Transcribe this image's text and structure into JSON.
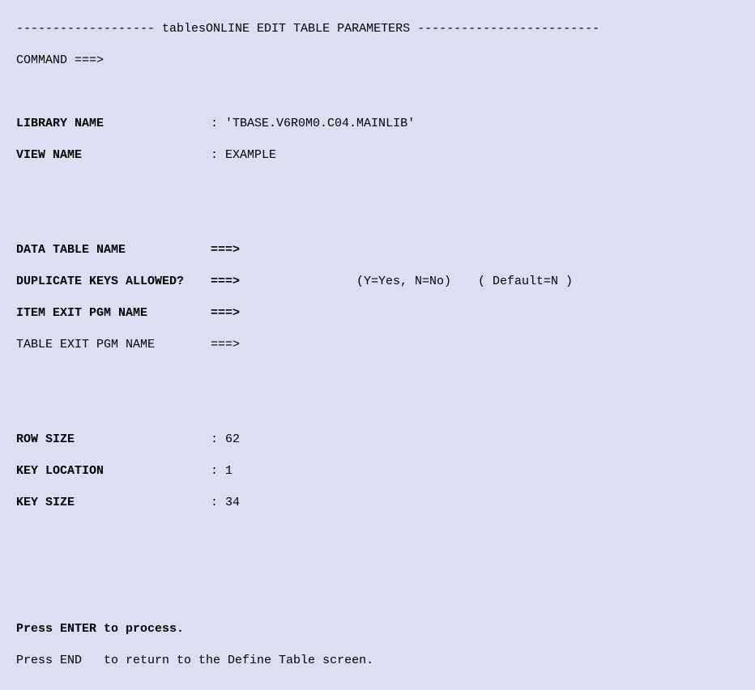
{
  "header": {
    "left_dash": "-------------------",
    "title": " tablesONLINE EDIT TABLE PARAMETERS ",
    "right_dash": "-------------------------"
  },
  "command": {
    "label": "COMMAND ===>"
  },
  "info": {
    "library_label": "LIBRARY NAME",
    "library_sep": ":",
    "library_value": "'TBASE.V6R0M0.C04.MAINLIB'",
    "view_label": "VIEW NAME",
    "view_sep": ":",
    "view_value": "EXAMPLE"
  },
  "inputs": {
    "data_table_label": "DATA TABLE NAME",
    "data_table_arrow": "===>",
    "dup_keys_label": "DUPLICATE KEYS ALLOWED?",
    "dup_keys_arrow": "===>",
    "dup_keys_hint1": "(Y=Yes, N=No)",
    "dup_keys_hint2": "( Default=N )",
    "item_exit_label": "ITEM EXIT PGM NAME",
    "item_exit_arrow": "===>",
    "table_exit_label": "TABLE EXIT PGM NAME",
    "table_exit_arrow": "===>"
  },
  "stats": {
    "row_size_label": "ROW SIZE",
    "row_size_sep": ":",
    "row_size_value": "62",
    "key_loc_label": "KEY LOCATION",
    "key_loc_sep": ":",
    "key_loc_value": "1",
    "key_size_label": "KEY SIZE",
    "key_size_sep": ":",
    "key_size_value": "34"
  },
  "footer": {
    "line1": "Press ENTER to process.",
    "line2": "Press END   to return to the Define Table screen."
  }
}
